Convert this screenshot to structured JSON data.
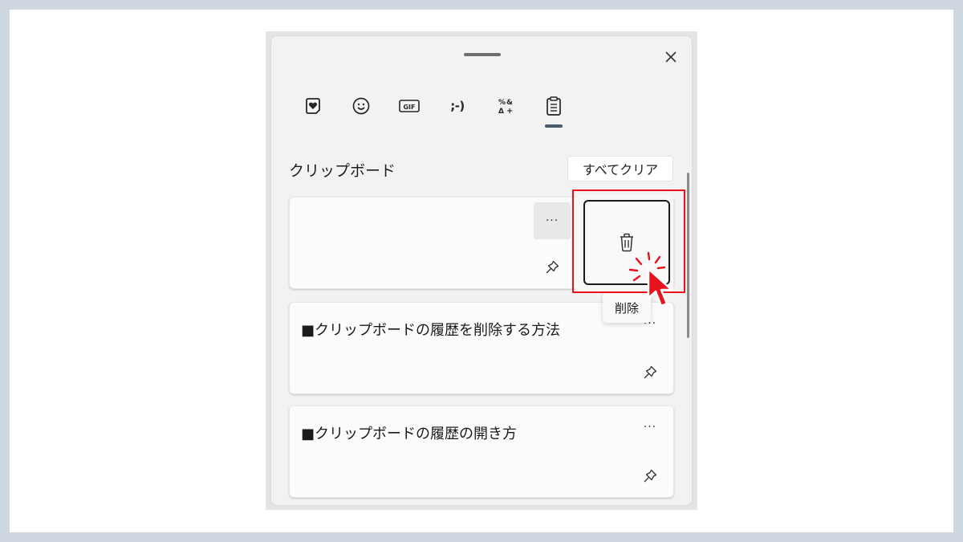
{
  "colors": {
    "background": "#cfd8e0",
    "panel": "#f2f2f2",
    "accent_indicator": "#4a5a6a",
    "highlight": "#e8121c"
  },
  "tabs": [
    {
      "name": "kaomoji-favorites",
      "icon": "heart-sticker-icon"
    },
    {
      "name": "emoji",
      "icon": "smiley-icon"
    },
    {
      "name": "gif",
      "icon": "gif-icon",
      "label": "GIF"
    },
    {
      "name": "kaomoji",
      "icon": "kaomoji-icon",
      "label": ";-)"
    },
    {
      "name": "symbols",
      "icon": "symbols-icon"
    },
    {
      "name": "clipboard",
      "icon": "clipboard-icon",
      "selected": true
    }
  ],
  "clipboard": {
    "title": "クリップボード",
    "clear_all_label": "すべてクリア",
    "items": [
      {
        "text": "",
        "more": "···"
      },
      {
        "text": "■クリップボードの履歴を削除する方法",
        "more": "···"
      },
      {
        "text": "■クリップボードの履歴の開き方",
        "more": "···"
      }
    ]
  },
  "context_menu": {
    "delete_icon": "trash-icon",
    "tooltip": "削除"
  }
}
